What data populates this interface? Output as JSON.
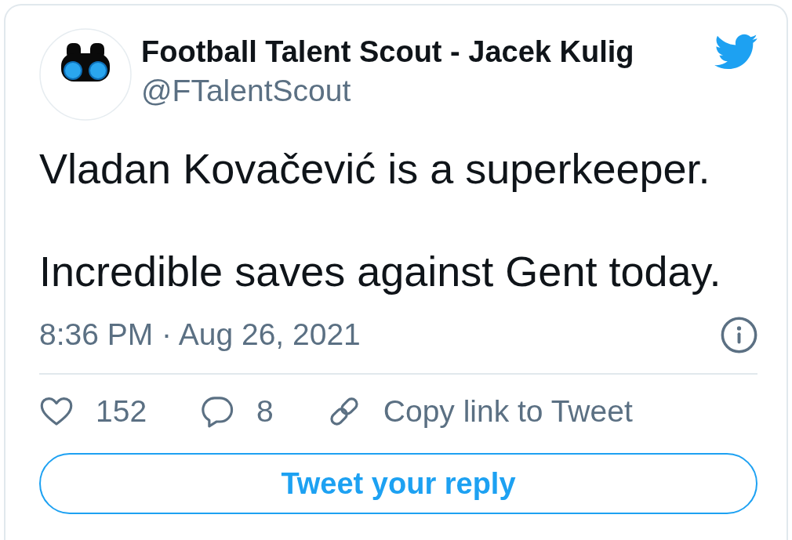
{
  "author": {
    "name": "Football Talent Scout - Jacek Kulig",
    "handle": "@FTalentScout"
  },
  "tweet": {
    "paragraphs": [
      "Vladan Kovačević is a superkeeper.",
      "Incredible saves against Gent today."
    ],
    "timestamp": "8:36 PM · Aug 26, 2021"
  },
  "actions": [
    {
      "kind": "like",
      "label": "152"
    },
    {
      "kind": "reply",
      "label": "8"
    },
    {
      "kind": "copy_link",
      "label": "Copy link to Tweet"
    }
  ],
  "reply_button": {
    "label": "Tweet your reply"
  }
}
